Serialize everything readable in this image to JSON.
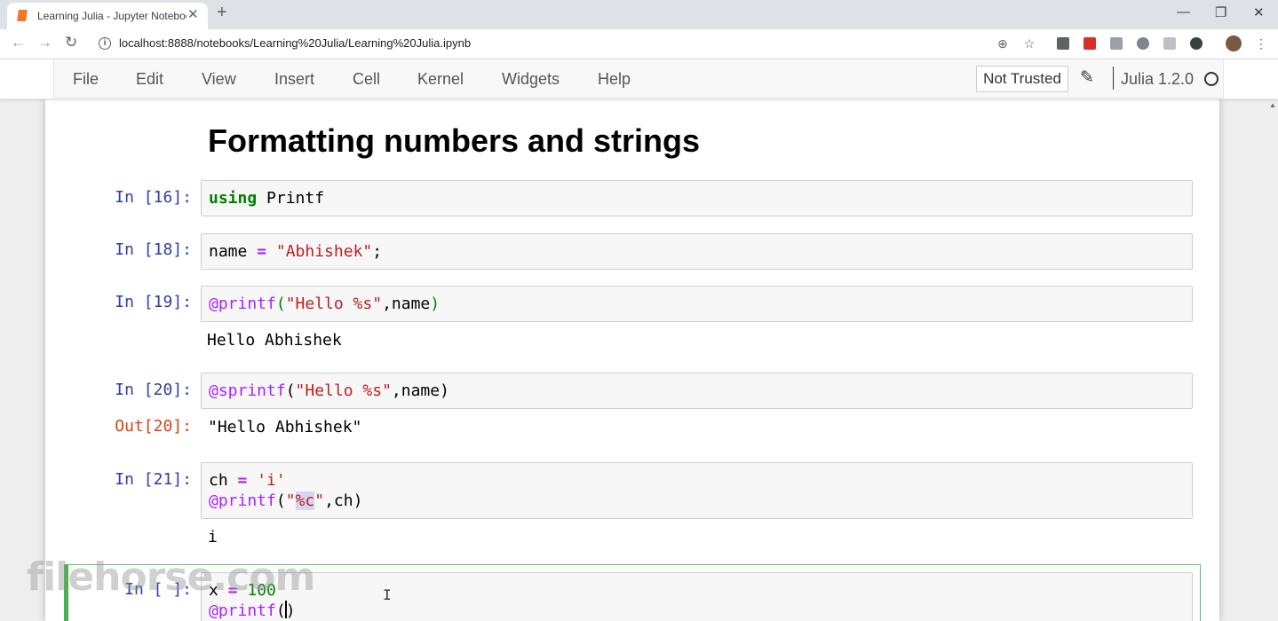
{
  "browser": {
    "tab_title": "Learning Julia - Jupyter Notebook",
    "url": "localhost:8888/notebooks/Learning%20Julia/Learning%20Julia.ipynb"
  },
  "menubar": {
    "items": [
      "File",
      "Edit",
      "View",
      "Insert",
      "Cell",
      "Kernel",
      "Widgets",
      "Help"
    ],
    "trust_label": "Not Trusted",
    "kernel_name": "Julia 1.2.0"
  },
  "notebook": {
    "heading": "Formatting numbers and strings",
    "cells": [
      {
        "prompt": "In [16]:",
        "code": [
          "using Printf"
        ]
      },
      {
        "prompt": "In [18]:",
        "code": [
          "name = \"Abhishek\";"
        ]
      },
      {
        "prompt": "In [19]:",
        "code": [
          "@printf(\"Hello %s\",name)"
        ],
        "output": "Hello Abhishek"
      },
      {
        "prompt": "In [20]:",
        "code": [
          "@sprintf(\"Hello %s\",name)"
        ],
        "out_prompt": "Out[20]:",
        "output": "\"Hello Abhishek\""
      },
      {
        "prompt": "In [21]:",
        "code": [
          "ch = 'i'",
          "@printf(\"%c\",ch)"
        ],
        "output": "i"
      },
      {
        "prompt": "In [ ]:",
        "code": [
          "x = 100",
          "@printf()"
        ]
      }
    ]
  },
  "watermark": "filehorse.com",
  "colors": {
    "prompt_in": "#303f9f",
    "prompt_out": "#d84315",
    "keyword": "#008000",
    "string": "#ba2121",
    "macro": "#aa22ff",
    "selected_border": "#4caf50"
  }
}
